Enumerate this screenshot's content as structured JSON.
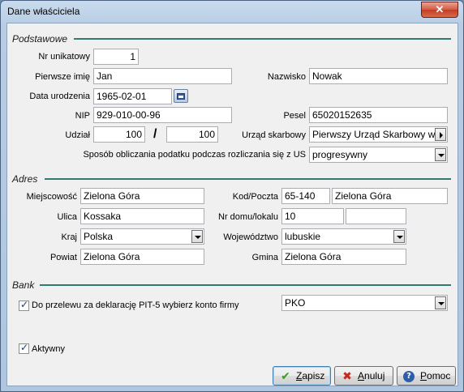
{
  "window": {
    "title": "Dane właściciela",
    "close_label": "✕"
  },
  "sections": {
    "basic": "Podstawowe",
    "address": "Adres",
    "bank": "Bank"
  },
  "basic": {
    "id_label": "Nr unikatowy",
    "id_value": "1",
    "firstname_label": "Pierwsze imię",
    "firstname_value": "Jan",
    "lastname_label": "Nazwisko",
    "lastname_value": "Nowak",
    "birthdate_label": "Data urodzenia",
    "birthdate_value": "1965-02-01",
    "nip_label": "NIP",
    "nip_value": "929-010-00-96",
    "pesel_label": "Pesel",
    "pesel_value": "65020152635",
    "share_label": "Udział",
    "share_num": "100",
    "share_sep": "/",
    "share_den": "100",
    "taxoffice_label": "Urząd skarbowy",
    "taxoffice_value": "Pierwszy Urząd Skarbowy w",
    "taxmethod_label": "Sposób obliczania podatku podczas rozliczania się z US",
    "taxmethod_value": "progresywny"
  },
  "address": {
    "city_label": "Miejscowość",
    "city_value": "Zielona Góra",
    "postal_label": "Kod/Poczta",
    "postal_code": "65-140",
    "postal_city": "Zielona Góra",
    "street_label": "Ulica",
    "street_value": "Kossaka",
    "house_label": "Nr domu/lokalu",
    "house_value": "10",
    "flat_value": "",
    "country_label": "Kraj",
    "country_value": "Polska",
    "voivodeship_label": "Województwo",
    "voivodeship_value": "lubuskie",
    "county_label": "Powiat",
    "county_value": "Zielona Góra",
    "commune_label": "Gmina",
    "commune_value": "Zielona Góra"
  },
  "bank": {
    "transfer_label": "Do przelewu za deklarację PIT-5 wybierz konto firmy",
    "transfer_checked": true,
    "account_value": "PKO"
  },
  "active": {
    "label": "Aktywny",
    "checked": true
  },
  "buttons": {
    "save": "Zapisz",
    "cancel": "Anuluj",
    "help": "Pomoc"
  },
  "icons": {
    "save": "check-icon",
    "cancel": "x-icon",
    "help": "help-icon",
    "calendar": "calendar-icon"
  }
}
